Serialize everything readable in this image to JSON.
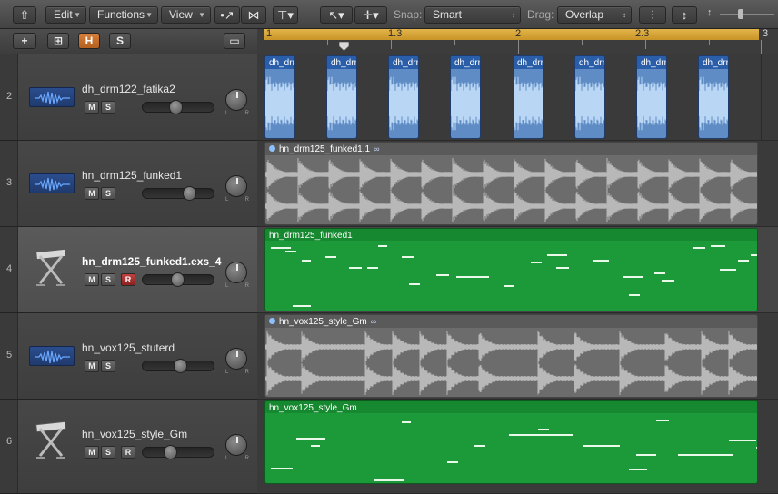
{
  "toolbar": {
    "back_icon": "up-arrow-icon",
    "edit_label": "Edit",
    "functions_label": "Functions",
    "view_label": "View",
    "snap_label": "Snap:",
    "snap_value": "Smart",
    "drag_label": "Drag:",
    "drag_value": "Overlap"
  },
  "header": {
    "add_label": "+",
    "folder_icon": "add-folder-icon",
    "h_label": "H",
    "s_label": "S"
  },
  "ruler": {
    "marks": [
      "1",
      "1.3",
      "2",
      "2.3",
      "3"
    ]
  },
  "tracks": [
    {
      "num": "2",
      "name": "dh_drm122_fatika2",
      "type": "audio-icon",
      "mute": "M",
      "solo": "S"
    },
    {
      "num": "3",
      "name": "hn_drm125_funked1",
      "type": "audio-icon",
      "mute": "M",
      "solo": "S"
    },
    {
      "num": "4",
      "name": "hn_drm125_funked1.exs_4",
      "type": "keyboard-icon",
      "mute": "M",
      "solo": "S",
      "record": "R",
      "selected": true
    },
    {
      "num": "5",
      "name": "hn_vox125_stuterd",
      "type": "audio-icon",
      "mute": "M",
      "solo": "S"
    },
    {
      "num": "6",
      "name": "hn_vox125_style_Gm",
      "type": "keyboard-icon",
      "mute": "M",
      "solo": "S",
      "record": "R"
    }
  ],
  "pan": {
    "left": "L",
    "right": "R"
  },
  "regions": {
    "drum_region_label": "dh_drm",
    "funked_region": "hn_drm125_funked1.1",
    "midi_region_1": "hn_drm125_funked1",
    "vox_region": "hn_vox125_style_Gm",
    "midi_region_2": "hn_vox125_style_Gm"
  },
  "colors": {
    "audio_blue": "#5f8cc5",
    "audio_gray": "#6c6c6c",
    "midi_green": "#1c9a3a",
    "cycle_yellow": "#d9a63a",
    "record_red": "#b33333",
    "hide_orange": "#c96c2b"
  }
}
